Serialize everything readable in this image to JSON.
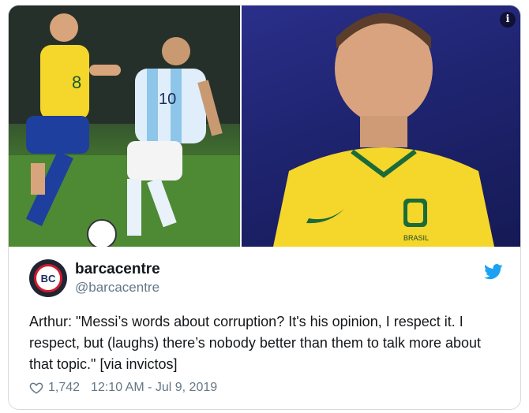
{
  "media": {
    "info_icon": "info-icon",
    "left_photo": "two-players-match-photo",
    "right_photo": "player-portrait-photo",
    "shirt_crest_text": "BRASIL",
    "jersey_number_left": "8",
    "jersey_number_center": "10",
    "colors": {
      "brazil_yellow": "#f5d62a",
      "argentina_blue": "#8ec6ea",
      "pitch_green": "#4f8a34",
      "backdrop": "#1f2470"
    }
  },
  "tweet": {
    "avatar_text": "BC",
    "display_name": "barcacentre",
    "handle": "@barcacentre",
    "text": "Arthur: \"Messi’s words about corruption? It's his opinion, I respect it.  I respect, but (laughs) there’s nobody better than them to talk more about that topic.\" [via invictos]",
    "likes": "1,742",
    "timestamp": "12:10 AM - Jul 9, 2019",
    "brand_color": "#1da1f2"
  }
}
